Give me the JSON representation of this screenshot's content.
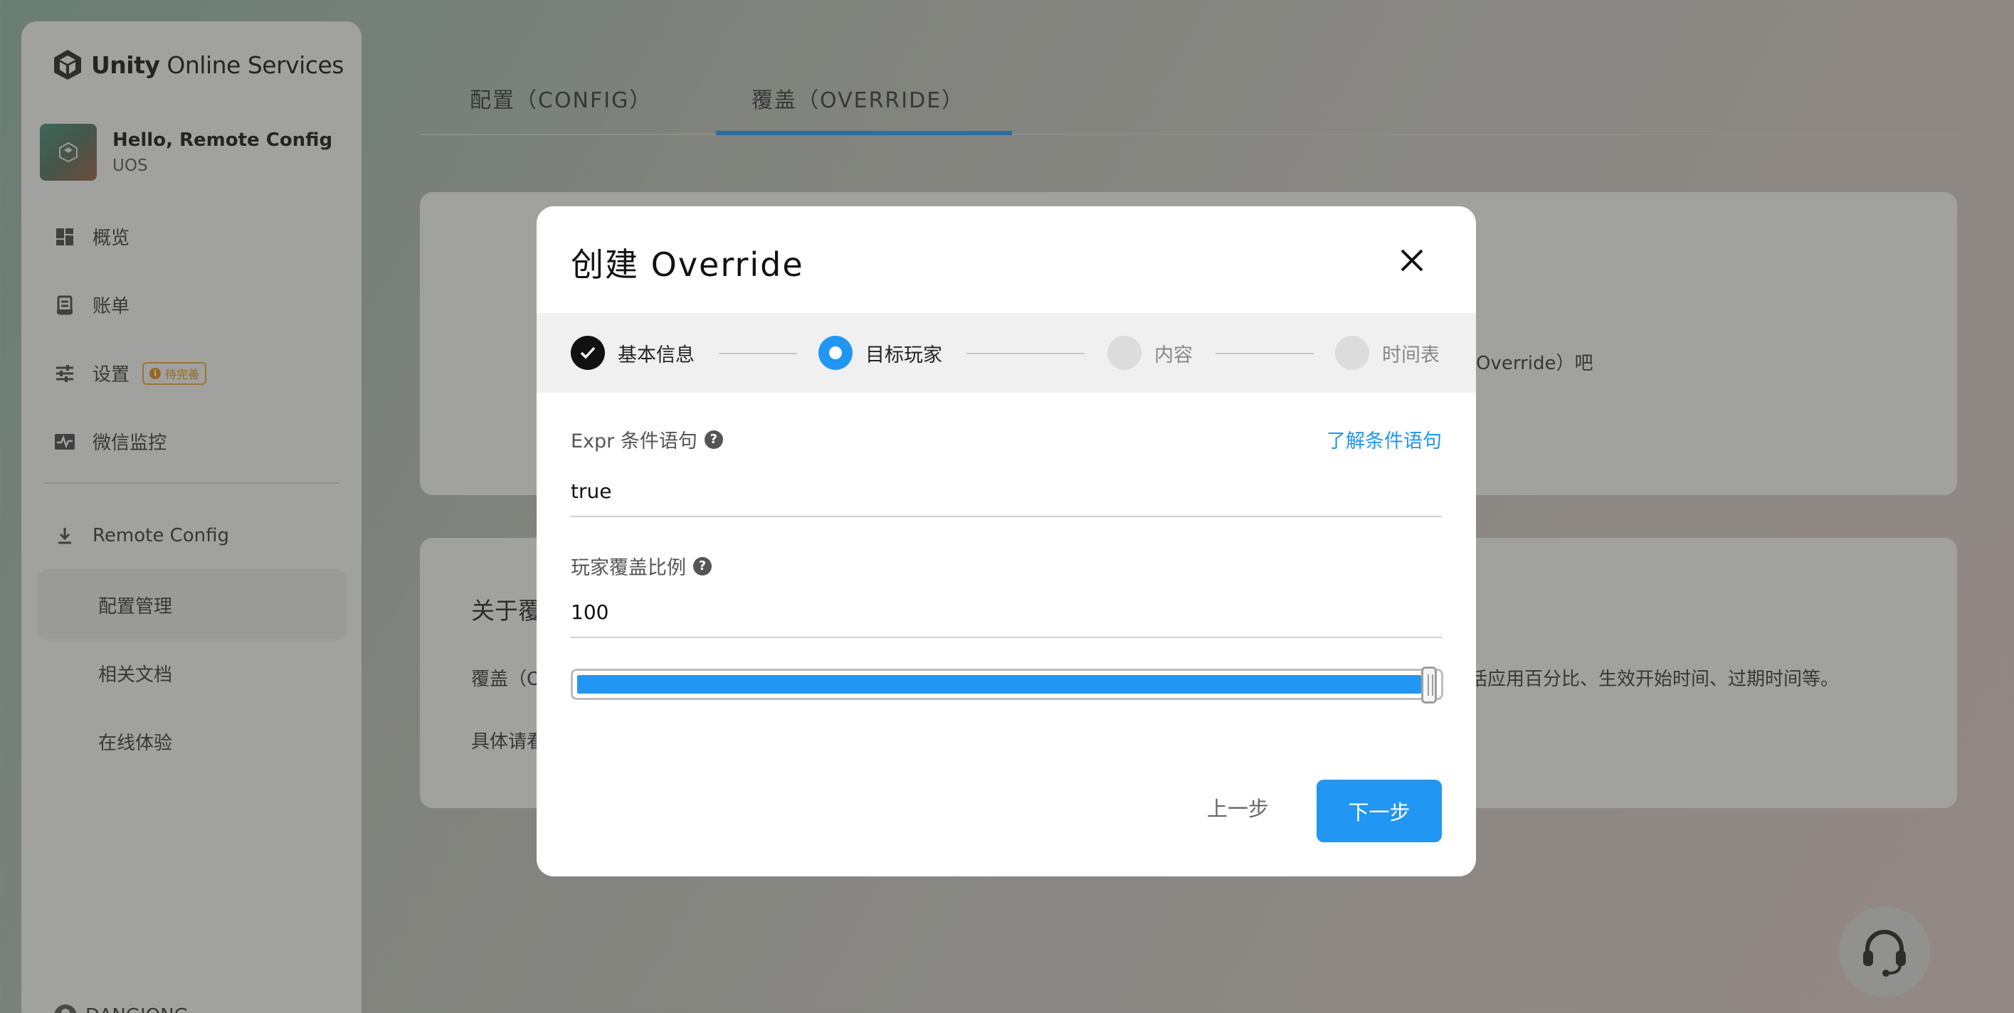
{
  "app": {
    "brand_bold": "Unity",
    "brand_rest": " Online Services"
  },
  "project": {
    "name": "Hello, Remote Config",
    "org": "UOS"
  },
  "sidebar": {
    "items": [
      {
        "label": "概览",
        "icon": "dashboard-icon"
      },
      {
        "label": "账单",
        "icon": "receipt-icon"
      },
      {
        "label": "设置",
        "icon": "settings-sliders-icon",
        "badge": "待完善"
      },
      {
        "label": "微信监控",
        "icon": "pulse-monitor-icon"
      }
    ],
    "product": {
      "label": "Remote Config",
      "icon": "download-icon"
    },
    "sub_items": [
      {
        "label": "配置管理",
        "active": true
      },
      {
        "label": "相关文档",
        "active": false
      },
      {
        "label": "在线体验",
        "active": false
      }
    ],
    "bottom_user": "DANGIONG"
  },
  "tabs": [
    {
      "label": "配置（CONFIG）",
      "active": false
    },
    {
      "label": "覆盖（OVERRIDE）",
      "active": true
    }
  ],
  "background": {
    "card1_text": "Override）吧",
    "card2_title": "关于覆",
    "card2_line1_left": "覆盖（O",
    "card2_line1_right": "括应用百分比、生效开始时间、过期时间等。",
    "card2_line2_left": "具体请看"
  },
  "modal": {
    "title": "创建 Override",
    "steps": [
      {
        "label": "基本信息",
        "state": "done"
      },
      {
        "label": "目标玩家",
        "state": "active"
      },
      {
        "label": "内容",
        "state": "pending"
      },
      {
        "label": "时间表",
        "state": "pending"
      }
    ],
    "expr_label": "Expr 条件语句",
    "expr_help": "?",
    "expr_link": "了解条件语句",
    "expr_value": "true",
    "ratio_label": "玩家覆盖比例",
    "ratio_help": "?",
    "ratio_value": "100",
    "slider_percent": 100,
    "prev_label": "上一步",
    "next_label": "下一步"
  },
  "colors": {
    "accent": "#2196f3",
    "badge": "#e08a10"
  }
}
